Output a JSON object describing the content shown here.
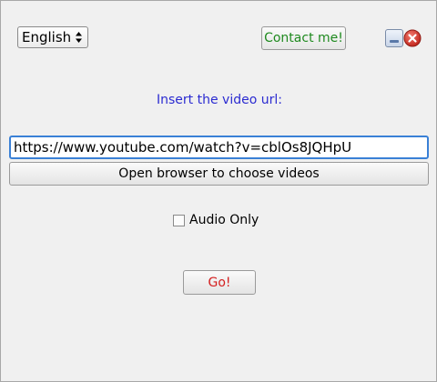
{
  "language_select": {
    "value": "English"
  },
  "header": {
    "contact_label": "Contact me!"
  },
  "main": {
    "prompt": "Insert the video url:",
    "url_value": "https://www.youtube.com/watch?v=cblOs8JQHpU",
    "browse_label": "Open browser to choose videos",
    "audio_only_label": "Audio Only",
    "audio_only_checked": false,
    "go_label": "Go!"
  },
  "colors": {
    "contact_text": "#1f8a1f",
    "prompt_text": "#2b2bd1",
    "go_text": "#d42020",
    "focus_border": "#3a80d6",
    "close_red": "#d9362e"
  },
  "icons": {
    "select_arrows": "up-down-arrows-icon",
    "minimize": "minimize-icon",
    "close": "close-icon"
  }
}
